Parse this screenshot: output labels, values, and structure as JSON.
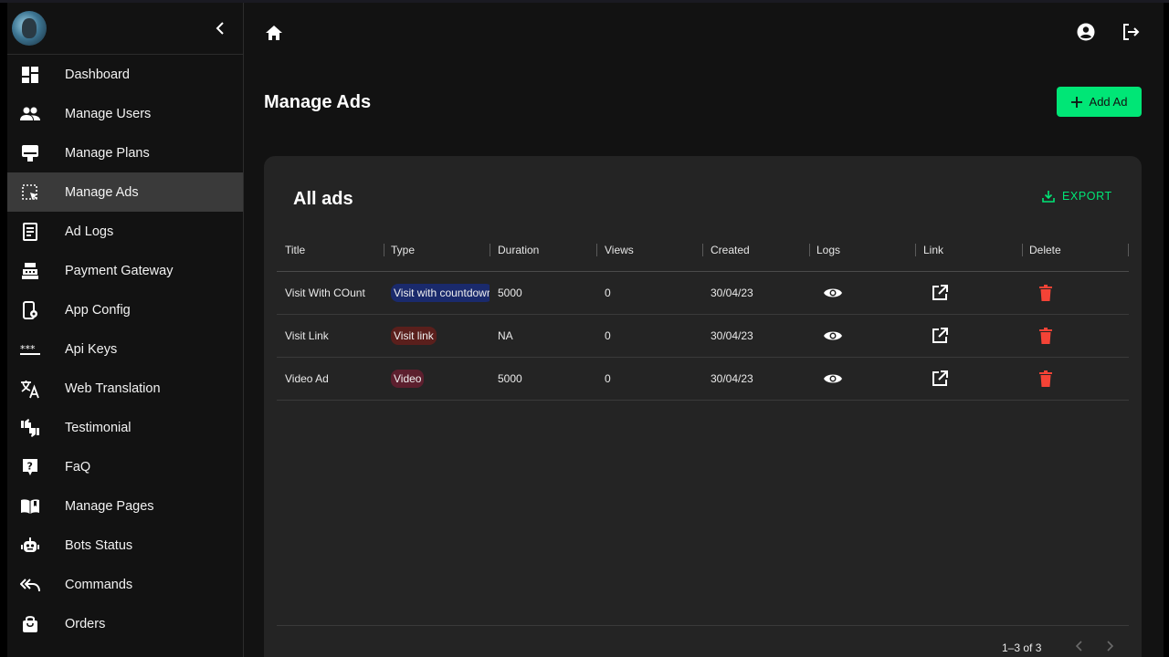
{
  "app": {
    "page_title": "Manage Ads"
  },
  "sidebar": {
    "items": [
      {
        "label": "Dashboard",
        "icon": "dashboard-icon"
      },
      {
        "label": "Manage Users",
        "icon": "users-icon"
      },
      {
        "label": "Manage Plans",
        "icon": "plans-icon"
      },
      {
        "label": "Manage Ads",
        "icon": "ads-icon",
        "active": true
      },
      {
        "label": "Ad Logs",
        "icon": "receipt-icon"
      },
      {
        "label": "Payment Gateway",
        "icon": "register-icon"
      },
      {
        "label": "App Config",
        "icon": "phone-settings-icon"
      },
      {
        "label": "Api Keys",
        "icon": "password-icon"
      },
      {
        "label": "Web Translation",
        "icon": "translate-icon"
      },
      {
        "label": "Testimonial",
        "icon": "thumbs-icon"
      },
      {
        "label": "FaQ",
        "icon": "help-icon"
      },
      {
        "label": "Manage Pages",
        "icon": "book-icon"
      },
      {
        "label": "Bots Status",
        "icon": "robot-icon"
      },
      {
        "label": "Commands",
        "icon": "reply-all-icon"
      },
      {
        "label": "Orders",
        "icon": "bag-icon"
      }
    ]
  },
  "toolbar": {
    "add_label": "Add Ad",
    "export_label": "EXPORT"
  },
  "card": {
    "title": "All ads"
  },
  "table": {
    "columns": [
      "Title",
      "Type",
      "Duration",
      "Views",
      "Created",
      "Logs",
      "Link",
      "Delete"
    ],
    "rows": [
      {
        "title": "Visit With COunt",
        "type": "Visit with countdowr",
        "duration": "5000",
        "views": "0",
        "created": "30/04/23"
      },
      {
        "title": "Visit Link",
        "type": "Visit link",
        "duration": "NA",
        "views": "0",
        "created": "30/04/23"
      },
      {
        "title": "Video Ad",
        "type": "Video",
        "duration": "5000",
        "views": "0",
        "created": "30/04/23"
      }
    ],
    "pagination": "1–3 of 3"
  },
  "colors": {
    "accent": "#00e676",
    "delete": "#f44336",
    "chip_countdown": "#1a2a6c",
    "chip_link": "#5a1f1c",
    "chip_video": "#5c1f2e"
  }
}
